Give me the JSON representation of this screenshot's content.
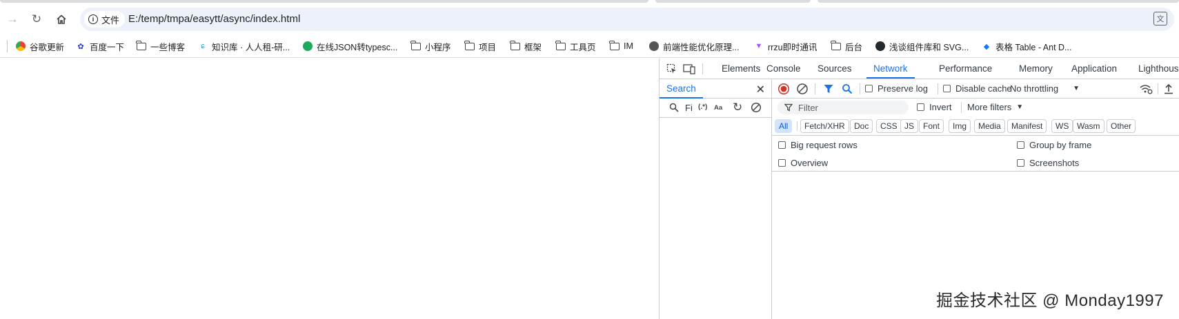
{
  "address_bar": {
    "chip_label": "文件",
    "url": "E:/temp/tmpa/easytt/async/index.html"
  },
  "bookmarks": [
    {
      "label": "谷歌更新",
      "icon": "chrome-icon"
    },
    {
      "label": "百度一下",
      "icon": "baidu-paw-icon"
    },
    {
      "label": "一些博客",
      "icon": "folder-icon"
    },
    {
      "label": "知识库 · 人人租-研...",
      "icon": "knowledge-icon"
    },
    {
      "label": "在线JSON转typesc...",
      "icon": "green-tool-icon"
    },
    {
      "label": "小程序",
      "icon": "folder-icon"
    },
    {
      "label": "项目",
      "icon": "folder-icon"
    },
    {
      "label": "框架",
      "icon": "folder-icon"
    },
    {
      "label": "工具页",
      "icon": "folder-icon"
    },
    {
      "label": "IM",
      "icon": "folder-icon"
    },
    {
      "label": "前端性能优化原理...",
      "icon": "globe-icon"
    },
    {
      "label": "rrzu即时通讯",
      "icon": "vite-icon"
    },
    {
      "label": "后台",
      "icon": "folder-icon"
    },
    {
      "label": "浅谈组件库和 SVG...",
      "icon": "github-icon"
    },
    {
      "label": "表格 Table - Ant D...",
      "icon": "antd-icon"
    }
  ],
  "devtools": {
    "tabs": [
      "Elements",
      "Console",
      "Sources",
      "Network",
      "Performance",
      "Memory",
      "Application",
      "Lighthouse"
    ],
    "active_tab": "Network",
    "search": {
      "title": "Search",
      "input_text": "Fi",
      "regex_label": "(.*)",
      "case_label": "Aa"
    },
    "network": {
      "preserve_log": "Preserve log",
      "disable_cache": "Disable cache",
      "throttling": "No throttling",
      "filter_placeholder": "Filter",
      "invert": "Invert",
      "more_filters": "More filters",
      "types": [
        "All",
        "Fetch/XHR",
        "Doc",
        "CSS",
        "JS",
        "Font",
        "Img",
        "Media",
        "Manifest",
        "WS",
        "Wasm",
        "Other"
      ],
      "active_type": "All",
      "settings": {
        "big_request_rows": "Big request rows",
        "group_by_frame": "Group by frame",
        "overview": "Overview",
        "screenshots": "Screenshots"
      }
    }
  },
  "watermark": "掘金技术社区 @ Monday1997",
  "colors": {
    "accent": "#1a73e8",
    "record_red": "#d93025",
    "omnibox_bg": "#edf2fa"
  }
}
